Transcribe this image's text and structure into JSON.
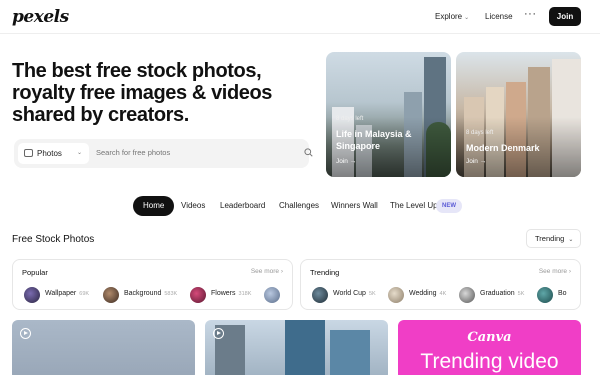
{
  "brand": {
    "logo": "pexels"
  },
  "nav": {
    "explore": "Explore",
    "license": "License",
    "more": "···",
    "join": "Join"
  },
  "hero": {
    "title": "The best free stock photos, royalty free images & videos shared by creators.",
    "search": {
      "type_label": "Photos",
      "placeholder": "Search for free photos"
    }
  },
  "hero_cards": [
    {
      "days": "8 days left",
      "title": "Life in Malaysia & Singapore",
      "join": "Join →"
    },
    {
      "days": "8 days left",
      "title": "Modern Denmark",
      "join": "Join →"
    }
  ],
  "tabs": [
    "Home",
    "Videos",
    "Leaderboard",
    "Challenges",
    "Winners Wall",
    "The Level Up"
  ],
  "tab_badge": "NEW",
  "section": {
    "title": "Free Stock Photos",
    "sort": "Trending"
  },
  "popular": {
    "title": "Popular",
    "see_more": "See more",
    "items": [
      {
        "name": "Wallpaper",
        "count": "69K"
      },
      {
        "name": "Background",
        "count": "583K"
      },
      {
        "name": "Flowers",
        "count": "318K"
      },
      {
        "name": "",
        "count": ""
      }
    ]
  },
  "trending": {
    "title": "Trending",
    "see_more": "See more",
    "items": [
      {
        "name": "World Cup",
        "count": "5K"
      },
      {
        "name": "Wedding",
        "count": "4K"
      },
      {
        "name": "Graduation",
        "count": "5K"
      },
      {
        "name": "Bo",
        "count": ""
      }
    ]
  },
  "promo": {
    "brand": "Canva",
    "text": "Trending video"
  },
  "colors": {
    "accent_dark": "#111111",
    "badge_bg": "#e6e6f8",
    "badge_fg": "#5a5ad6",
    "promo_bg": "#f03ec6"
  }
}
